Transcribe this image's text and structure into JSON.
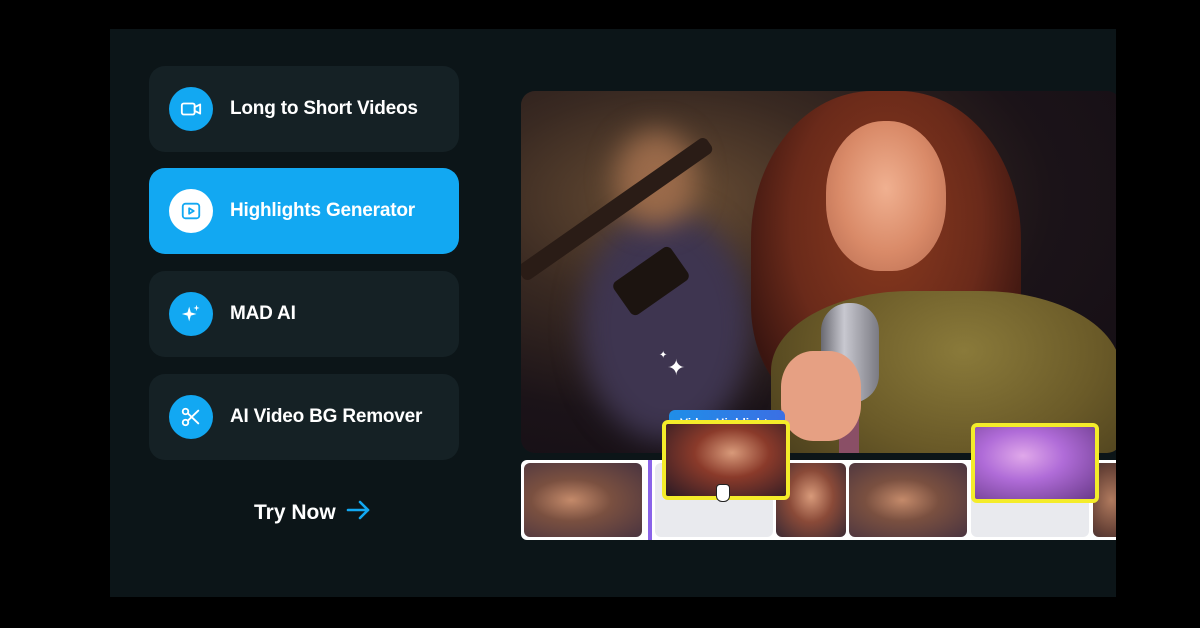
{
  "menu": {
    "items": [
      {
        "label": "Long to Short Videos",
        "icon": "video-camera-icon",
        "active": false
      },
      {
        "label": "Highlights Generator",
        "icon": "play-square-icon",
        "active": true
      },
      {
        "label": "MAD AI",
        "icon": "sparkle-icon",
        "active": false
      },
      {
        "label": "AI Video BG Remover",
        "icon": "scissors-icon",
        "active": false
      }
    ]
  },
  "cta": {
    "label": "Try Now",
    "icon": "arrow-right-icon"
  },
  "preview": {
    "tag_label": "Video Highlights"
  },
  "colors": {
    "accent": "#12a8f2",
    "panel": "#0c1518",
    "card": "#152125",
    "highlight_border": "#f4ec2a",
    "playhead": "#8a63e8"
  }
}
